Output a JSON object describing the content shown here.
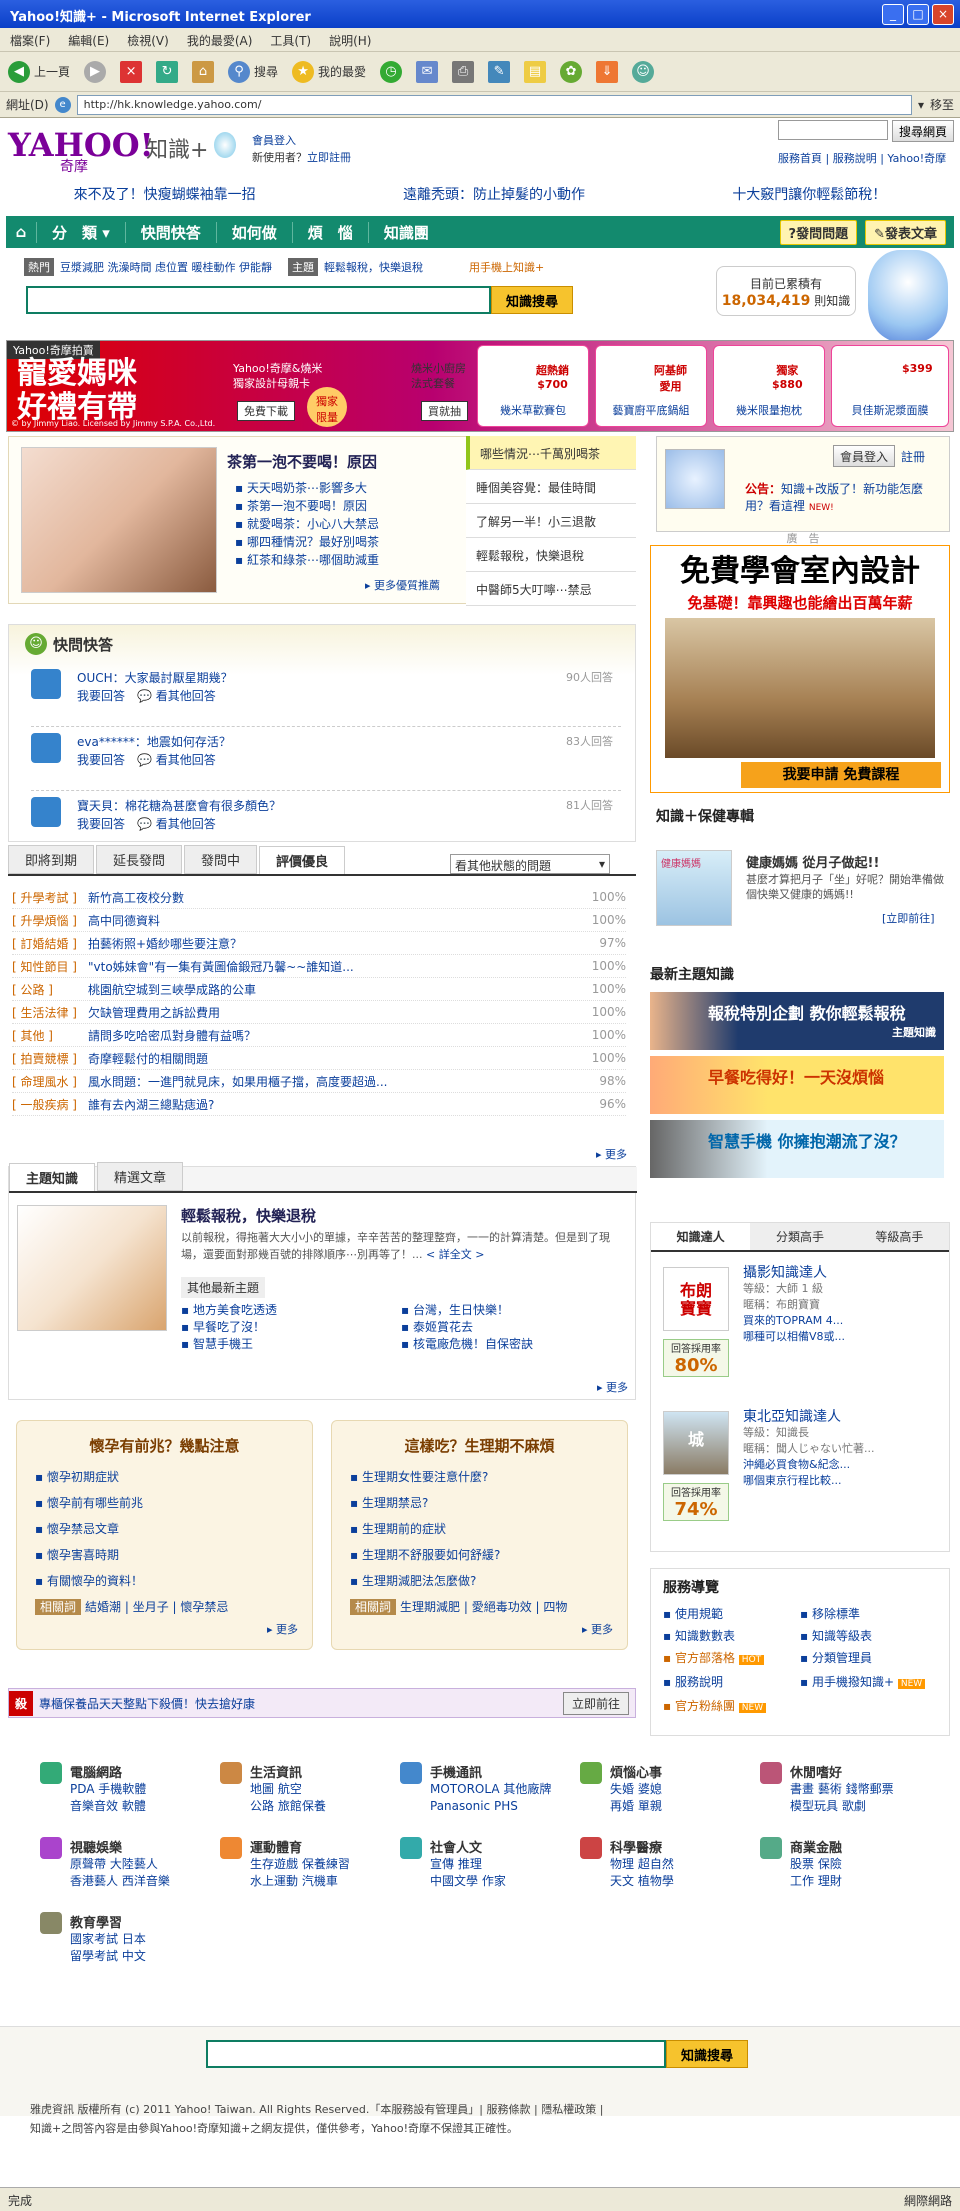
{
  "window": {
    "title": "Yahoo!知識+ - Microsoft Internet Explorer",
    "btn_min": "_",
    "btn_max": "□",
    "btn_close": "×"
  },
  "menu": [
    "檔案(F)",
    "編輯(E)",
    "檢視(V)",
    "我的最愛(A)",
    "工具(T)",
    "說明(H)"
  ],
  "toolbar": {
    "back": "上一頁",
    "search": "搜尋",
    "favorites": "我的最愛"
  },
  "address": {
    "label": "網址(D)",
    "url": "http://hk.knowledge.yahoo.com/",
    "go": "移至"
  },
  "header": {
    "logo": "YAHOO!",
    "logo_sub": "奇摩",
    "brand": "知識+",
    "login": "會員登入",
    "new_user": "新使用者？",
    "register": "立即註冊",
    "search_btn": "搜尋網頁",
    "links": "服務首頁 | 服務說明 | Yahoo!奇摩"
  },
  "promo": [
    "來不及了！快瘦蝴蝶袖靠一招",
    "遠離秃頭：防止掉髮的小動作",
    "十大竅門讓你輕鬆節稅！"
  ],
  "nav": {
    "home": "⌂",
    "items": [
      "分　類 ▾",
      "快問快答",
      "如何做",
      "煩　惱",
      "知識團"
    ],
    "ask": "?發問問題",
    "post": "✎發表文章"
  },
  "hot": {
    "tag": "熱門",
    "items": "豆漿減肥  洗澡時間  虑位置  暖桂動作  伊能靜",
    "topic_tag": "主題",
    "topic": "輕鬆報稅，快樂退稅",
    "mobile": "用手機上知識+"
  },
  "search": {
    "btn": "知識搜尋"
  },
  "counter": {
    "line1": "目前已累積有",
    "num": "18,034,419",
    "unit": "則知識"
  },
  "adstrip": {
    "tag": "Yahoo!奇摩拍賣",
    "big1": "寵愛媽咪",
    "big2": "好禮有帶",
    "mid": "Yahoo!奇摩&燒米\n獨家設計母親卡",
    "free": "免費下載",
    "excl": "獨家\n限量",
    "kit": "燒米小廚房\n法式套餐",
    "buy": "買就抽",
    "credit": "© by Jimmy Liao. Licensed by Jimmy S.P.A. Co.,Ltd.",
    "products": [
      {
        "price": "超熱銷\n$700",
        "label": "幾米草歡賽包"
      },
      {
        "price": "阿基師\n愛用",
        "label": "藝寶廚平底鍋組"
      },
      {
        "price": "獨家\n$880",
        "label": "幾米限量抱枕"
      },
      {
        "price": "$399",
        "label": "貝佳斯泥漿面膜"
      }
    ]
  },
  "feature": {
    "title": "茶第一泡不要喝！原因",
    "items": [
      "天天喝奶茶⋯影響多大",
      "茶第一泡不要喝！原因",
      "就愛喝茶：小心八大禁忌",
      "哪四種情況？最好別喝茶",
      "紅茶和綠茶⋯哪個助減重"
    ],
    "more": "更多優質推薦",
    "tabs": [
      "哪些情況⋯千萬別喝茶",
      "睡個美容覺：最佳時間",
      "了解另一半！小三退散",
      "輕鬆報稅，快樂退稅",
      "中醫師5大叮嚀⋯禁忌"
    ]
  },
  "qa": {
    "title": "快問快答",
    "answer": "我要回答",
    "others": "看其他回答",
    "items": [
      {
        "user": "OUCH",
        "q": "大家最討厭星期幾？",
        "count": "90人回答"
      },
      {
        "user": "eva******",
        "q": "地震如何存活？",
        "count": "83人回答"
      },
      {
        "user": "寶天貝",
        "q": "棉花糖為甚麼會有很多顏色？",
        "count": "81人回答"
      }
    ]
  },
  "tabs2": {
    "items": [
      "即將到期",
      "延長發問",
      "發問中",
      "評價優良"
    ],
    "select": "看其他狀態的問題"
  },
  "rows": [
    {
      "c": "[ 升學考試 ]",
      "t": "新竹高工夜校分數",
      "p": "100%"
    },
    {
      "c": "[ 升學煩惱 ]",
      "t": "高中同德資料",
      "p": "100%"
    },
    {
      "c": "[ 訂婚結婚 ]",
      "t": "拍藝術照+婚紗哪些要注意？",
      "p": "97%"
    },
    {
      "c": "[ 知性節目 ]",
      "t": "\"vto姊妹會\"有一集有黃圖倫鍛冠乃馨~~誰知道...",
      "p": "100%"
    },
    {
      "c": "[ 公路 ]",
      "t": "桃園航空城到三峽學成路的公車",
      "p": "100%"
    },
    {
      "c": "[ 生活法律 ]",
      "t": "欠缺管理費用之訴訟費用",
      "p": "100%"
    },
    {
      "c": "[ 其他 ]",
      "t": "請問多吃哈密瓜對身體有益嗎？",
      "p": "100%"
    },
    {
      "c": "[ 拍賣競標 ]",
      "t": "奇摩輕鬆付的相關問題",
      "p": "100%"
    },
    {
      "c": "[ 命理風水 ]",
      "t": "風水問題：一進門就見床，如果用櫃子擋，高度要超過...",
      "p": "98%"
    },
    {
      "c": "[ 一般疾病 ]",
      "t": "誰有去內湖三總點痣過?",
      "p": "96%"
    }
  ],
  "more": "更多",
  "theme": {
    "tabs": [
      "主題知識",
      "精選文章"
    ],
    "title": "輕鬆報稅，快樂退稅",
    "body": "以前報稅，得拖著大大小小的單據，辛辛苦苦的整理整齊，一一的計算清楚。但是到了現場，還要面對那幾百號的排隊順序⋯別再等了！...",
    "detail": "< 詳全文 >",
    "other": "其他最新主題",
    "list": [
      "地方美食吃透透",
      "台灣，生日快樂！",
      "早餐吃了沒！",
      "泰姬賞花去",
      "智慧手機王",
      "核電廠危機！自保密訣"
    ]
  },
  "box1": {
    "title": "懷孕有前兆？幾點注意",
    "items": [
      "懷孕初期症狀",
      "懷孕前有哪些前兆",
      "懷孕禁忌文章",
      "懷孕害喜時期",
      "有關懷孕的資料！"
    ],
    "kwtag": "相關詞",
    "kw": "結婚潮 | 坐月子 | 懷孕禁忌"
  },
  "box2": {
    "title": "這樣吃？生理期不麻煩",
    "items": [
      "生理期女性要注意什麼?",
      "生理期禁忌?",
      "生理期前的症狀",
      "生理期不舒服要如何舒緩?",
      "生理期減肥法怎麼做?"
    ],
    "kwtag": "相關詞",
    "kw": "生理期減肥 | 愛絕毒功效 | 四物"
  },
  "bar": {
    "mark": "殺",
    "text": "專櫃保養品天天整點下殺價！快去搶好康",
    "go": "立即前往"
  },
  "notice": {
    "login": "會員登入",
    "register": "註冊",
    "label": "公告：",
    "text": "知識+改版了！新功能怎麼用？看這裡",
    "new": "NEW!"
  },
  "ad": {
    "label": "廣　告",
    "head": "免費學會室內設計",
    "sub": "免基礎！靠興趣也能繪出百萬年薪",
    "cta": "我要申請 免費課程"
  },
  "health": {
    "title": "知識＋保健專輯",
    "head": "健康媽媽 從月子做起!!",
    "body": "甚麼才算把月子「坐」好呢？開始準備做個快樂又健康的媽媽!!",
    "more": "[立即前往]",
    "thumb": "健康媽媽"
  },
  "newk": {
    "title": "最新主題知識",
    "b1": "報稅特別企劃 教你輕鬆報稅",
    "b1sub": "主題知識",
    "b2": "早餐吃得好！一天沒煩惱",
    "b3": "智慧手機 你擁抱潮流了沒？"
  },
  "experts": {
    "tabs": [
      "知識達人",
      "分類高手",
      "等級高手"
    ],
    "rate_label": "回答採用率",
    "list": [
      {
        "logo": "布朗\n寶寶",
        "name": "攝影知識達人",
        "level": "等級：大師 1 級",
        "nick": "暱稱：布朗寶寶",
        "a1": "買來的TOPRAM 4...",
        "a2": "哪種可以相備V8或...",
        "rate": "80%"
      },
      {
        "logo": "城",
        "name": "東北亞知識達人",
        "level": "等級：知識長",
        "nick": "暱稱：聞人じゃない忙著...",
        "a1": "沖繩必買食物&紀念...",
        "a2": "哪個東京行程比較...",
        "rate": "74%"
      }
    ]
  },
  "services": {
    "title": "服務導覽",
    "items": [
      "使用規範",
      "移除標準",
      "知識數數表",
      "知識等級表",
      "官方部落格",
      "分類管理員",
      "服務說明",
      "用手機撥知識+",
      "官方粉絲團",
      ""
    ],
    "hot": "HOT",
    "new": "NEW"
  },
  "cats": [
    {
      "name": "電腦網路",
      "l1": "PDA 手機軟體",
      "l2": "音樂音效 軟體"
    },
    {
      "name": "生活資訊",
      "l1": "地圖 航空",
      "l2": "公路 旅館保養"
    },
    {
      "name": "手機通訊",
      "l1": "MOTOROLA 其他廠牌",
      "l2": "Panasonic PHS"
    },
    {
      "name": "煩惱心事",
      "l1": "失婚 婆媳",
      "l2": "再婚 單親"
    },
    {
      "name": "休閒嗜好",
      "l1": "書畫 藝術 錢幣郵票",
      "l2": "模型玩具 歌劇"
    },
    {
      "name": "視聽娛樂",
      "l1": "原聲帶 大陸藝人",
      "l2": "香港藝人 西洋音樂"
    },
    {
      "name": "運動體育",
      "l1": "生存遊戲 保養練習",
      "l2": "水上運動 汽機車"
    },
    {
      "name": "社會人文",
      "l1": "宣傳 推理",
      "l2": "中國文學 作家"
    },
    {
      "name": "科學醫療",
      "l1": "物理 超自然",
      "l2": "天文 植物學"
    },
    {
      "name": "商業金融",
      "l1": "股票 保險",
      "l2": "工作 理財"
    },
    {
      "name": "教育學習",
      "l1": "國家考試 日本",
      "l2": "留學考試 中文"
    }
  ],
  "footer": {
    "btn": "知識搜尋",
    "copy1": "雅虎資訊 版權所有 (c) 2011 Yahoo! Taiwan. All Rights Reserved.「本服務設有管理員」| 服務條款 | 隱私權政策 |",
    "copy2": "知識+之問答內容是由參與Yahoo!奇摩知識+之網友提供，僅供參考，Yahoo!奇摩不保證其正確性。"
  },
  "status": {
    "left": "完成",
    "right": "網際網路"
  }
}
